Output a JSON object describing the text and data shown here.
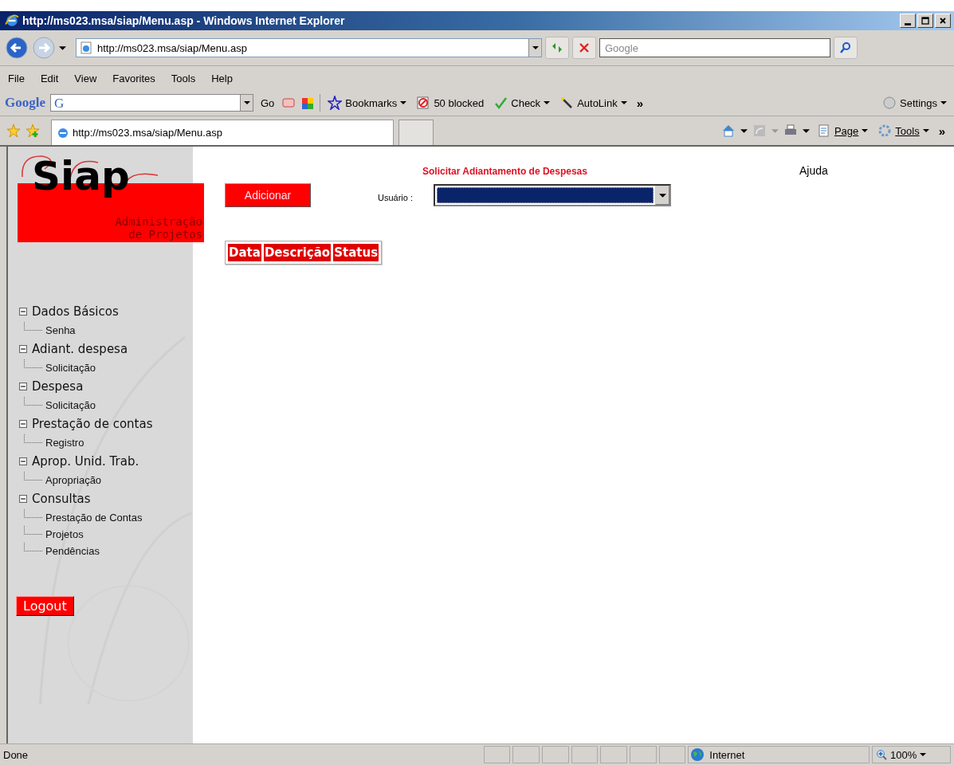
{
  "window": {
    "title": "http://ms023.msa/siap/Menu.asp - Windows Internet Explorer"
  },
  "address_bar": {
    "url": "http://ms023.msa/siap/Menu.asp"
  },
  "search": {
    "placeholder": "Google"
  },
  "menu": [
    "File",
    "Edit",
    "View",
    "Favorites",
    "Tools",
    "Help"
  ],
  "google_toolbar": {
    "logo": "Google",
    "field_logo": "G",
    "go": "Go",
    "items": [
      {
        "label": "Bookmarks",
        "kind": "star"
      },
      {
        "label": "50 blocked",
        "kind": "popup"
      },
      {
        "label": "Check",
        "kind": "spell"
      },
      {
        "label": "AutoLink",
        "kind": "wand"
      }
    ],
    "more": "»",
    "settings": "Settings"
  },
  "tab": {
    "title": "http://ms023.msa/siap/Menu.asp"
  },
  "command_bar": {
    "items": [
      "Page",
      "Tools"
    ],
    "more": "»"
  },
  "page": {
    "logo": "Siap",
    "logo_subtitle": [
      "Administração",
      "de Projetos"
    ],
    "nav": [
      {
        "label": "Dados Básicos",
        "expanded": true,
        "children": [
          {
            "label": "Senha"
          }
        ]
      },
      {
        "label": "Adiant. despesa",
        "expanded": true,
        "children": [
          {
            "label": "Solicitação"
          }
        ]
      },
      {
        "label": "Despesa",
        "expanded": true,
        "children": [
          {
            "label": "Solicitação"
          }
        ]
      },
      {
        "label": "Prestação de contas",
        "expanded": true,
        "children": [
          {
            "label": "Registro"
          }
        ]
      },
      {
        "label": "Aprop. Unid. Trab.",
        "expanded": true,
        "children": [
          {
            "label": "Apropriação"
          }
        ]
      },
      {
        "label": "Consultas",
        "expanded": true,
        "children": [
          {
            "label": "Prestação de Contas"
          },
          {
            "label": "Projetos"
          },
          {
            "label": "Pendências"
          }
        ]
      }
    ],
    "logout": "Logout",
    "heading": "Solicitar Adiantamento de Despesas",
    "help": "Ajuda",
    "add_button": "Adicionar",
    "user_label": "Usuário :",
    "table": {
      "columns": [
        "Data",
        "Descrição",
        "Status"
      ]
    }
  },
  "status_bar": {
    "text": "Done",
    "zone": "Internet",
    "zoom": "100%"
  }
}
